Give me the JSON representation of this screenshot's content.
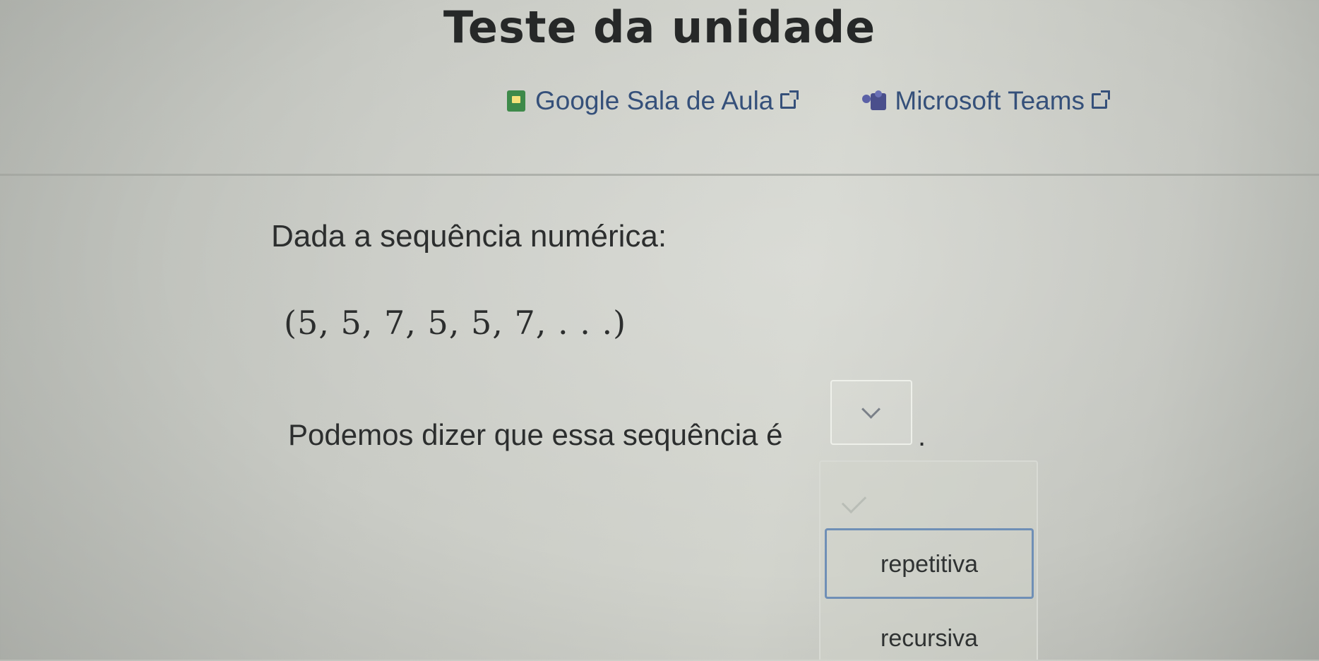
{
  "header": {
    "title": "Teste da unidade"
  },
  "share": {
    "google_classroom": "Google Sala de Aula",
    "microsoft_teams": "Microsoft Teams"
  },
  "question": {
    "intro": "Dada a sequência numérica:",
    "sequence": "(5, 5, 7, 5, 5, 7, . . .)",
    "prompt": "Podemos dizer que essa sequência é",
    "suffix": "."
  },
  "dropdown": {
    "options": [
      {
        "label": "repetitiva",
        "state": "highlighted"
      },
      {
        "label": "recursiva",
        "state": "normal"
      }
    ]
  },
  "colors": {
    "link": "#35507a",
    "highlight_border": "#6f8fb6"
  }
}
